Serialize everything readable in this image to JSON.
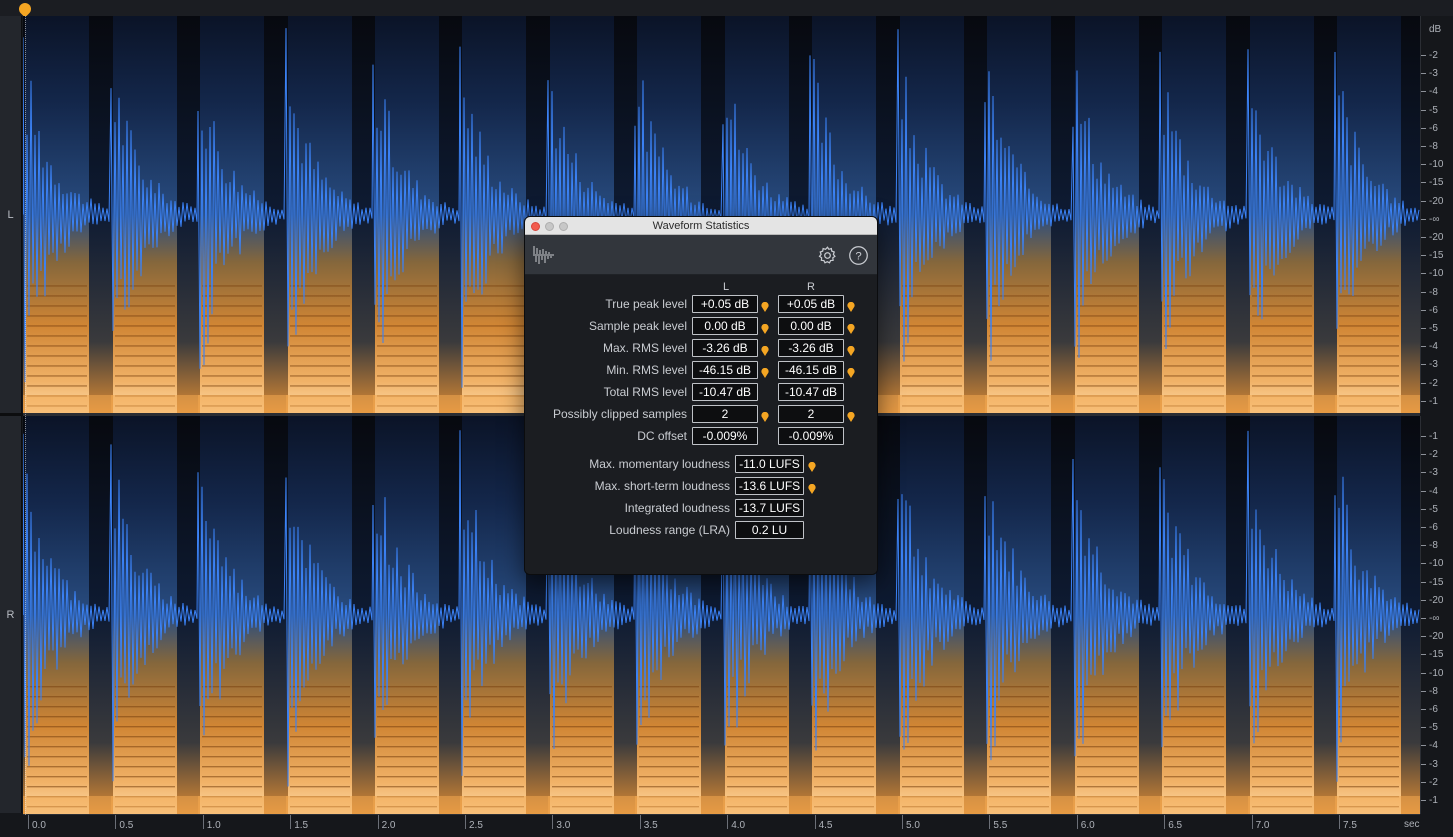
{
  "channels": {
    "left": "L",
    "right": "R"
  },
  "db_scale": {
    "unit": "dB",
    "left_ticks": [
      "-2",
      "-3",
      "-4",
      "-5",
      "-6",
      "-8",
      "-10",
      "-15",
      "-20",
      "-∞",
      "-20",
      "-15",
      "-10",
      "-8",
      "-6",
      "-5",
      "-4",
      "-3",
      "-2",
      "-1"
    ],
    "right_ticks": [
      "-1",
      "-2",
      "-3",
      "-4",
      "-5",
      "-6",
      "-8",
      "-10",
      "-15",
      "-20",
      "-∞",
      "-20",
      "-15",
      "-10",
      "-8",
      "-6",
      "-5",
      "-4",
      "-3",
      "-2",
      "-1"
    ]
  },
  "ruler": {
    "unit": "sec",
    "ticks": [
      "0.0",
      "0.5",
      "1.0",
      "1.5",
      "2.0",
      "2.5",
      "3.0",
      "3.5",
      "4.0",
      "4.5",
      "5.0",
      "5.5",
      "6.0",
      "6.5",
      "7.0",
      "7.5"
    ]
  },
  "dialog": {
    "title": "Waveform Statistics",
    "col_left": "L",
    "col_right": "R",
    "rows": [
      {
        "label": "True peak level",
        "L": "+0.05 dB",
        "R": "+0.05 dB",
        "pinL": true,
        "pinR": true
      },
      {
        "label": "Sample peak level",
        "L": "0.00 dB",
        "R": "0.00 dB",
        "pinL": true,
        "pinR": true
      },
      {
        "label": "Max. RMS level",
        "L": "-3.26 dB",
        "R": "-3.26 dB",
        "pinL": true,
        "pinR": true
      },
      {
        "label": "Min. RMS level",
        "L": "-46.15 dB",
        "R": "-46.15 dB",
        "pinL": true,
        "pinR": true
      },
      {
        "label": "Total RMS level",
        "L": "-10.47 dB",
        "R": "-10.47 dB",
        "pinL": false,
        "pinR": false
      },
      {
        "label": "Possibly clipped samples",
        "L": "2",
        "R": "2",
        "pinL": true,
        "pinR": true
      },
      {
        "label": "DC offset",
        "L": "-0.009%",
        "R": "-0.009%",
        "pinL": false,
        "pinR": false
      }
    ],
    "loudness": [
      {
        "label": "Max. momentary loudness",
        "value": "-11.0 LUFS",
        "pin": true
      },
      {
        "label": "Max. short-term loudness",
        "value": "-13.6 LUFS",
        "pin": true
      },
      {
        "label": "Integrated loudness",
        "value": "-13.7 LUFS",
        "pin": false
      },
      {
        "label": "Loudness range (LRA)",
        "value": "0.2 LU",
        "pin": false
      }
    ]
  },
  "icons": {
    "playhead": "playhead-marker-icon",
    "logo": "waveform-statistics-icon",
    "gear": "gear-icon",
    "help": "help-icon",
    "pin": "location-pin-icon"
  },
  "colors": {
    "waveform": "#3b82f6",
    "spectrogram_low": "#0a1426",
    "spectrogram_high": "#f5a544",
    "marker": "#f5a623"
  }
}
